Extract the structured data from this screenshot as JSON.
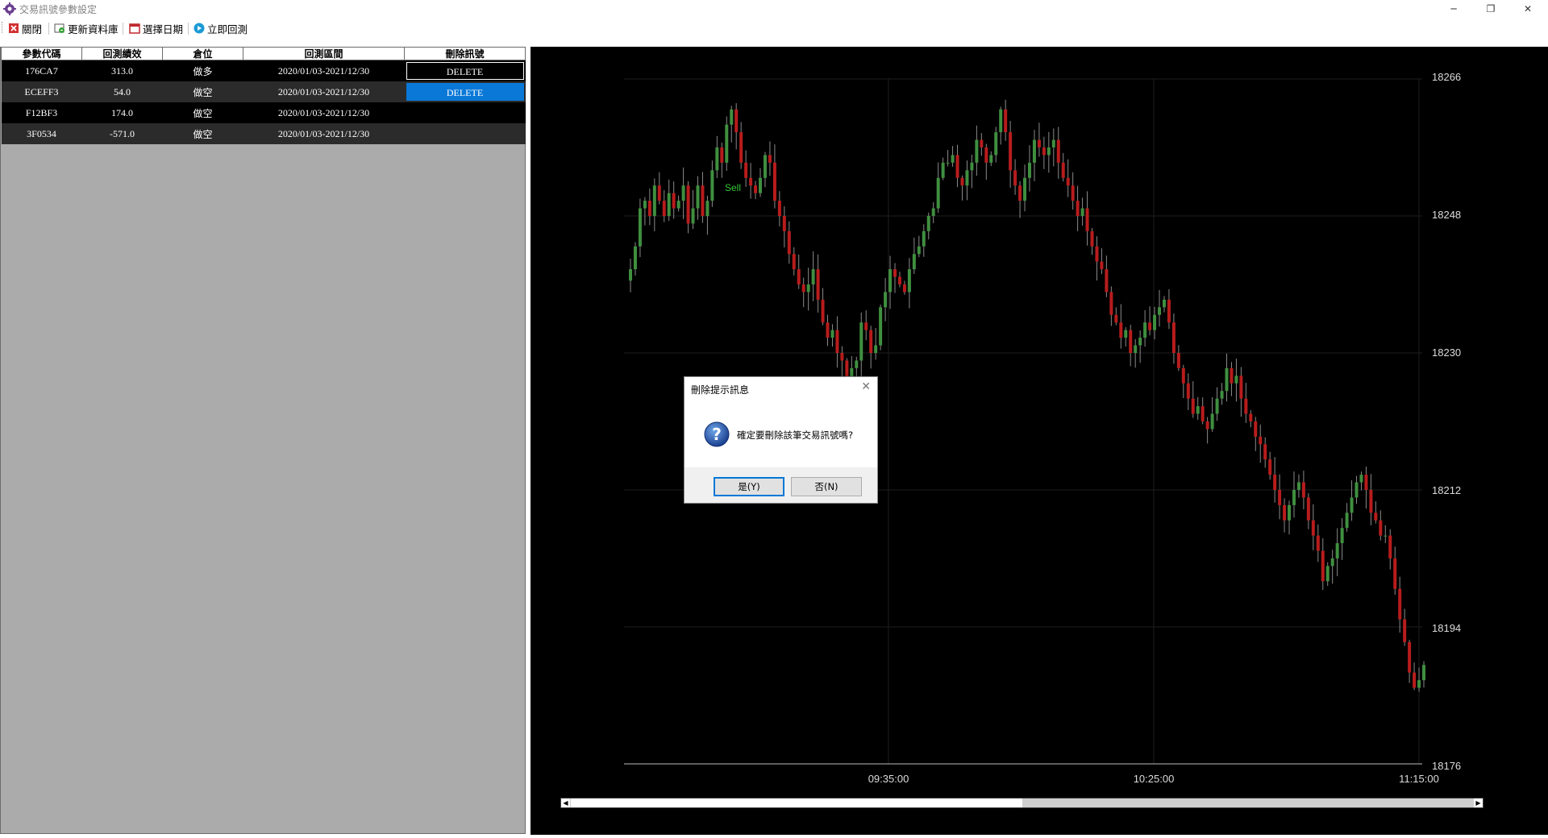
{
  "window": {
    "title": "交易訊號參數設定",
    "minimize_glyph": "─",
    "restore_glyph": "❐",
    "close_glyph": "✕",
    "app_icon": "gear-icon"
  },
  "toolbar": {
    "items": [
      {
        "label": "關閉",
        "icon": "close-icon"
      },
      {
        "label": "更新資料庫",
        "icon": "database-refresh-icon"
      },
      {
        "label": "選擇日期",
        "icon": "calendar-icon"
      },
      {
        "label": "立即回測",
        "icon": "play-icon"
      }
    ]
  },
  "table": {
    "headers": [
      "參數代碼",
      "回測績效",
      "倉位",
      "回測區間",
      "刪除訊號"
    ],
    "rows": [
      {
        "code": "176CA7",
        "perf": "313.0",
        "position": "做多",
        "range": "2020/01/03-2021/12/30",
        "action": "DELETE"
      },
      {
        "code": "ECEFF3",
        "perf": "54.0",
        "position": "做空",
        "range": "2020/01/03-2021/12/30",
        "action": "DELETE"
      },
      {
        "code": "F12BF3",
        "perf": "174.0",
        "position": "做空",
        "range": "2020/01/03-2021/12/30",
        "action": ""
      },
      {
        "code": "3F0534",
        "perf": "-571.0",
        "position": "做空",
        "range": "2020/01/03-2021/12/30",
        "action": ""
      }
    ]
  },
  "chart": {
    "price_labels": [
      "18266",
      "18248",
      "18230",
      "18212",
      "18194",
      "18176"
    ],
    "time_labels": [
      "09:35:00",
      "10:25:00",
      "11:15:00"
    ],
    "signal_label": "Sell",
    "up_color": "#3f8f3f",
    "down_color": "#b81c1c"
  },
  "chart_data": {
    "type": "candlestick",
    "y_ticks": [
      18266,
      18248,
      18230,
      18212,
      18194,
      18176
    ],
    "ylim": [
      18176,
      18266
    ],
    "x_ticks": [
      "09:35:00",
      "10:25:00",
      "11:15:00"
    ],
    "grid": true,
    "annotations": [
      "Sell"
    ],
    "close_series": [
      18241,
      18244,
      18249,
      18250,
      18248,
      18252,
      18250,
      18248,
      18251,
      18249,
      18250,
      18252,
      18247,
      18249,
      18252,
      18248,
      18250,
      18254,
      18257,
      18255,
      18260,
      18262,
      18259,
      18255,
      18253,
      18252,
      18251,
      18253,
      18256,
      18255,
      18250,
      18248,
      18246,
      18243,
      18241,
      18239,
      18238,
      18239,
      18241,
      18237,
      18234,
      18232,
      18233,
      18230,
      18229,
      18226,
      18228,
      18229,
      18234,
      18233,
      18230,
      18231,
      18236,
      18238,
      18241,
      18240,
      18239,
      18238,
      18241,
      18243,
      18244,
      18246,
      18248,
      18249,
      18253,
      18255,
      18255,
      18256,
      18253,
      18252,
      18254,
      18255,
      18258,
      18257,
      18255,
      18256,
      18259,
      18262,
      18259,
      18254,
      18252,
      18250,
      18253,
      18255,
      18258,
      18257,
      18256,
      18257,
      18258,
      18255,
      18253,
      18252,
      18250,
      18248,
      18249,
      18246,
      18244,
      18242,
      18241,
      18238,
      18235,
      18234,
      18232,
      18233,
      18230,
      18231,
      18232,
      18234,
      18233,
      18235,
      18236,
      18237,
      18234,
      18230,
      18228,
      18226,
      18224,
      18222,
      18223,
      18221,
      18220,
      18222,
      18224,
      18225,
      18228,
      18226,
      18227,
      18224,
      18222,
      18221,
      18219,
      18218,
      18216,
      18214,
      18212,
      18210,
      18208,
      18210,
      18212,
      18213,
      18211,
      18208,
      18206,
      18204,
      18200,
      18202,
      18203,
      18205,
      18207,
      18209,
      18211,
      18213,
      18214,
      18212,
      18209,
      18208,
      18206,
      18206,
      18203,
      18199,
      18195,
      18192,
      18188,
      18186,
      18187,
      18189
    ]
  }
}
